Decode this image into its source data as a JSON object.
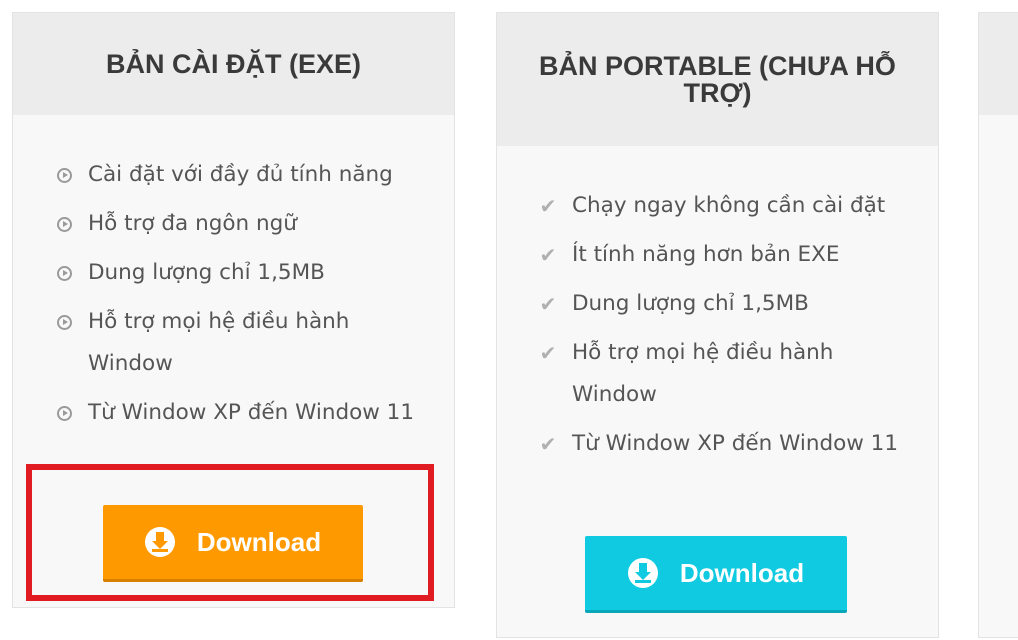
{
  "cards": [
    {
      "title": "BẢN CÀI ĐẶT (EXE)",
      "features": [
        "Cài đặt với đầy đủ tính năng",
        "Hỗ trợ đa ngôn ngữ",
        "Dung lượng chỉ 1,5MB",
        "Hỗ trợ mọi hệ điều hành Window",
        "Từ Window XP đến Window 11"
      ],
      "bullet_icon": "circle-play-icon",
      "button_label": "Download",
      "button_color": "#ff9900",
      "highlighted": true
    },
    {
      "title": "BẢN PORTABLE (CHƯA HỖ TRỢ)",
      "features": [
        "Chạy ngay không cần cài đặt",
        "Ít tính năng hơn bản EXE",
        "Dung lượng chỉ 1,5MB",
        "Hỗ trợ mọi hệ điều hành Window",
        "Từ Window XP đến Window 11"
      ],
      "bullet_icon": "check-icon",
      "button_label": "Download",
      "button_color": "#0fcae0",
      "highlighted": false
    }
  ],
  "colors": {
    "highlight_border": "#e11b22",
    "header_bg": "#ececec",
    "card_bg": "#f8f8f8"
  }
}
